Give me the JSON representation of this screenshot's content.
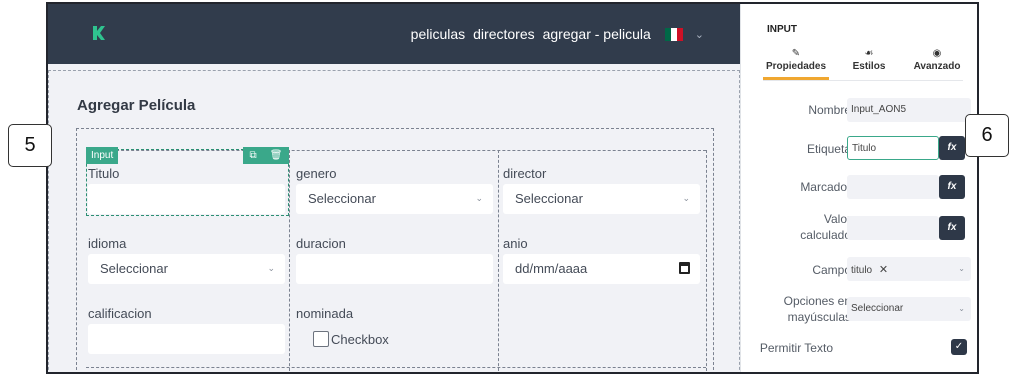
{
  "navbar": {
    "links": [
      "peliculas",
      "directores",
      "agregar - pelicula"
    ],
    "flag_colors": [
      "#006847",
      "#ffffff",
      "#ce1126"
    ]
  },
  "page": {
    "title": "Agregar Película"
  },
  "selection": {
    "badge": "Input"
  },
  "form": {
    "titulo_label": "Titulo",
    "genero_label": "genero",
    "genero_value": "Seleccionar",
    "director_label": "director",
    "director_value": "Seleccionar",
    "idioma_label": "idioma",
    "idioma_value": "Seleccionar",
    "duracion_label": "duracion",
    "anio_label": "anio",
    "anio_placeholder": "dd/mm/aaaa",
    "calificacion_label": "calificacion",
    "nominada_label": "nominada",
    "checkbox_label": "Checkbox"
  },
  "panel": {
    "title": "INPUT",
    "tabs": [
      "Propiedades",
      "Estilos",
      "Avanzado"
    ],
    "nombre_label": "Nombre",
    "nombre_value": "Input_AON5",
    "etiqueta_label": "Etiqueta",
    "etiqueta_value": "Titulo",
    "marcador_label": "Marcador",
    "valor_label": "Valor calculado",
    "campo_label": "Campo",
    "campo_value": "titulo",
    "opciones_label": "Opciones en mayúsculas",
    "opciones_value": "Seleccionar",
    "permitir_label": "Permitir Texto",
    "fx": "fx"
  },
  "callouts": [
    "5",
    "6"
  ],
  "colors": {
    "navbar": "#313c4c",
    "accent_green": "#3aa88a",
    "tab_underline": "#f0a730",
    "fx_button": "#2e3848",
    "logo": "#2fc38f"
  }
}
